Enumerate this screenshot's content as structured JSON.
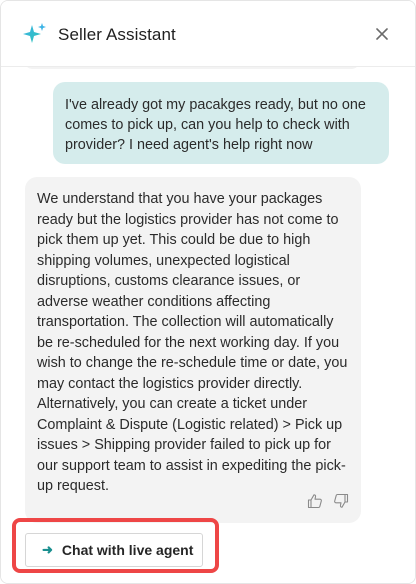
{
  "header": {
    "title": "Seller Assistant",
    "icon": "sparkle-icon",
    "close_icon": "close-icon"
  },
  "messages": {
    "user": "I've already got my pacakges ready, but no one comes to pick up, can you help to check with provider? I need agent's help right now",
    "assistant": "We understand that you have your packages ready but the logistics provider has not come to pick them up yet. This could be due to high shipping volumes, unexpected logistical disruptions, customs clearance issues, or adverse weather conditions affecting transportation. The collection will automatically be re-scheduled for the next working day. If you wish to change the re-schedule time or date, you may contact the logistics provider directly. Alternatively, you can create a ticket under Complaint & Dispute (Logistic related) > Pick up issues > Shipping provider failed to pick up for our support team to assist in expediting the pick-up request."
  },
  "feedback": {
    "like_icon": "thumbs-up-icon",
    "dislike_icon": "thumbs-down-icon"
  },
  "actions": {
    "live_agent_label": "Chat with live agent",
    "live_agent_icon": "arrow-right-icon"
  },
  "colors": {
    "accent": "#1a8f8f",
    "user_bubble": "#d5ecec",
    "bot_bubble": "#f3f3f3",
    "highlight": "#ee4646"
  }
}
